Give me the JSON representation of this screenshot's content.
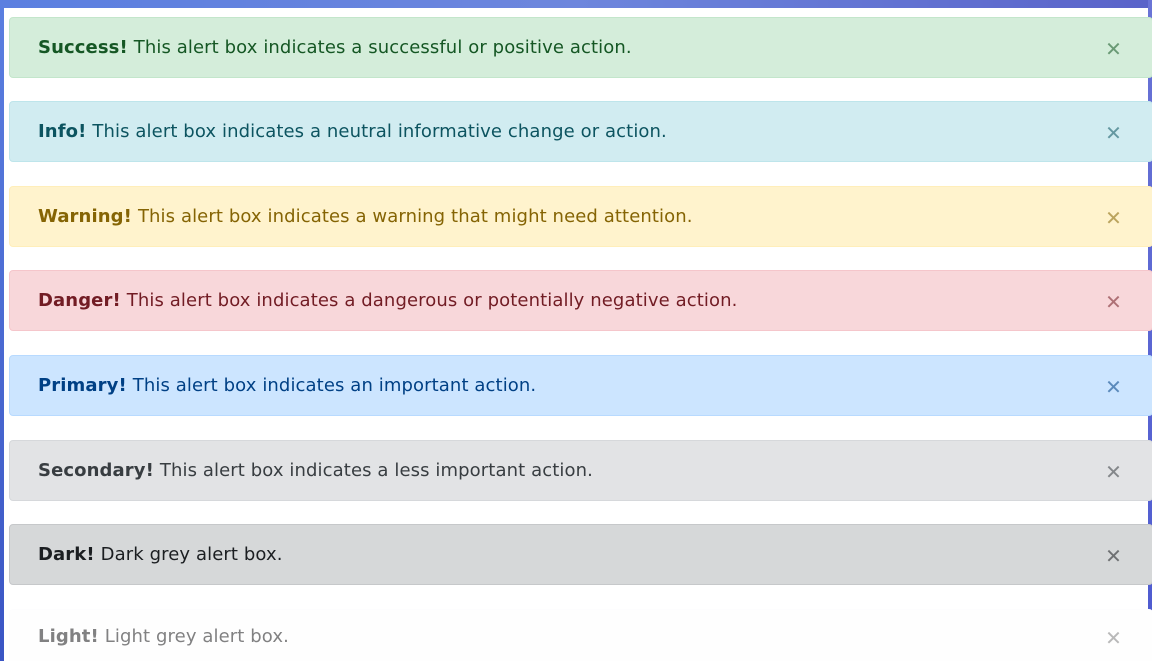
{
  "alerts": [
    {
      "label": "Success!",
      "message": "This alert box indicates a successful or positive action.",
      "close": "✕"
    },
    {
      "label": "Info!",
      "message": "This alert box indicates a neutral informative change or action.",
      "close": "✕"
    },
    {
      "label": "Warning!",
      "message": "This alert box indicates a warning that might need attention.",
      "close": "✕"
    },
    {
      "label": "Danger!",
      "message": "This alert box indicates a dangerous or potentially negative action.",
      "close": "✕"
    },
    {
      "label": "Primary!",
      "message": "This alert box indicates an important action.",
      "close": "✕"
    },
    {
      "label": "Secondary!",
      "message": "This alert box indicates a less important action.",
      "close": "✕"
    },
    {
      "label": "Dark!",
      "message": "Dark grey alert box.",
      "close": "✕"
    },
    {
      "label": "Light!",
      "message": "Light grey alert box.",
      "close": "✕"
    }
  ],
  "colors": {
    "success": "#155724",
    "info": "#0c5460",
    "warning": "#856404",
    "danger": "#721c24",
    "primary": "#004085",
    "secondary": "#383d41",
    "dark": "#1b1e21",
    "light": "#818182"
  }
}
